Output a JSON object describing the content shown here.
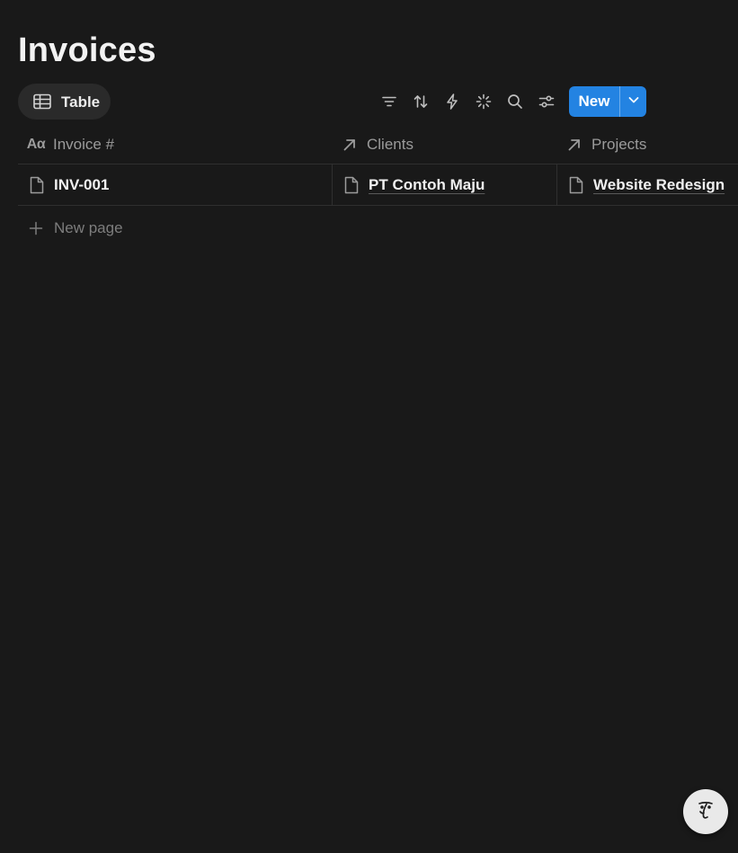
{
  "page": {
    "title": "Invoices"
  },
  "toolbar": {
    "view_tab_label": "Table",
    "new_button_label": "New",
    "icons": [
      "filter-icon",
      "sort-icon",
      "automation-icon",
      "ai-sparkle-icon",
      "search-icon",
      "settings-sliders-icon",
      "chevron-down-icon"
    ]
  },
  "table": {
    "columns": [
      {
        "label": "Invoice #",
        "icon": "text-property-icon"
      },
      {
        "label": "Clients",
        "icon": "relation-arrow-icon"
      },
      {
        "label": "Projects",
        "icon": "relation-arrow-icon"
      }
    ],
    "rows": [
      {
        "invoice": "INV-001",
        "client": "PT Contoh Maju",
        "project": "Website Redesign"
      }
    ],
    "new_page_label": "New page"
  },
  "help": {
    "icon": "notion-ai-face-icon"
  },
  "colors": {
    "background": "#191919",
    "accent": "#2383e2",
    "muted_text": "#9b9b9b",
    "border": "#2f2f2f"
  }
}
